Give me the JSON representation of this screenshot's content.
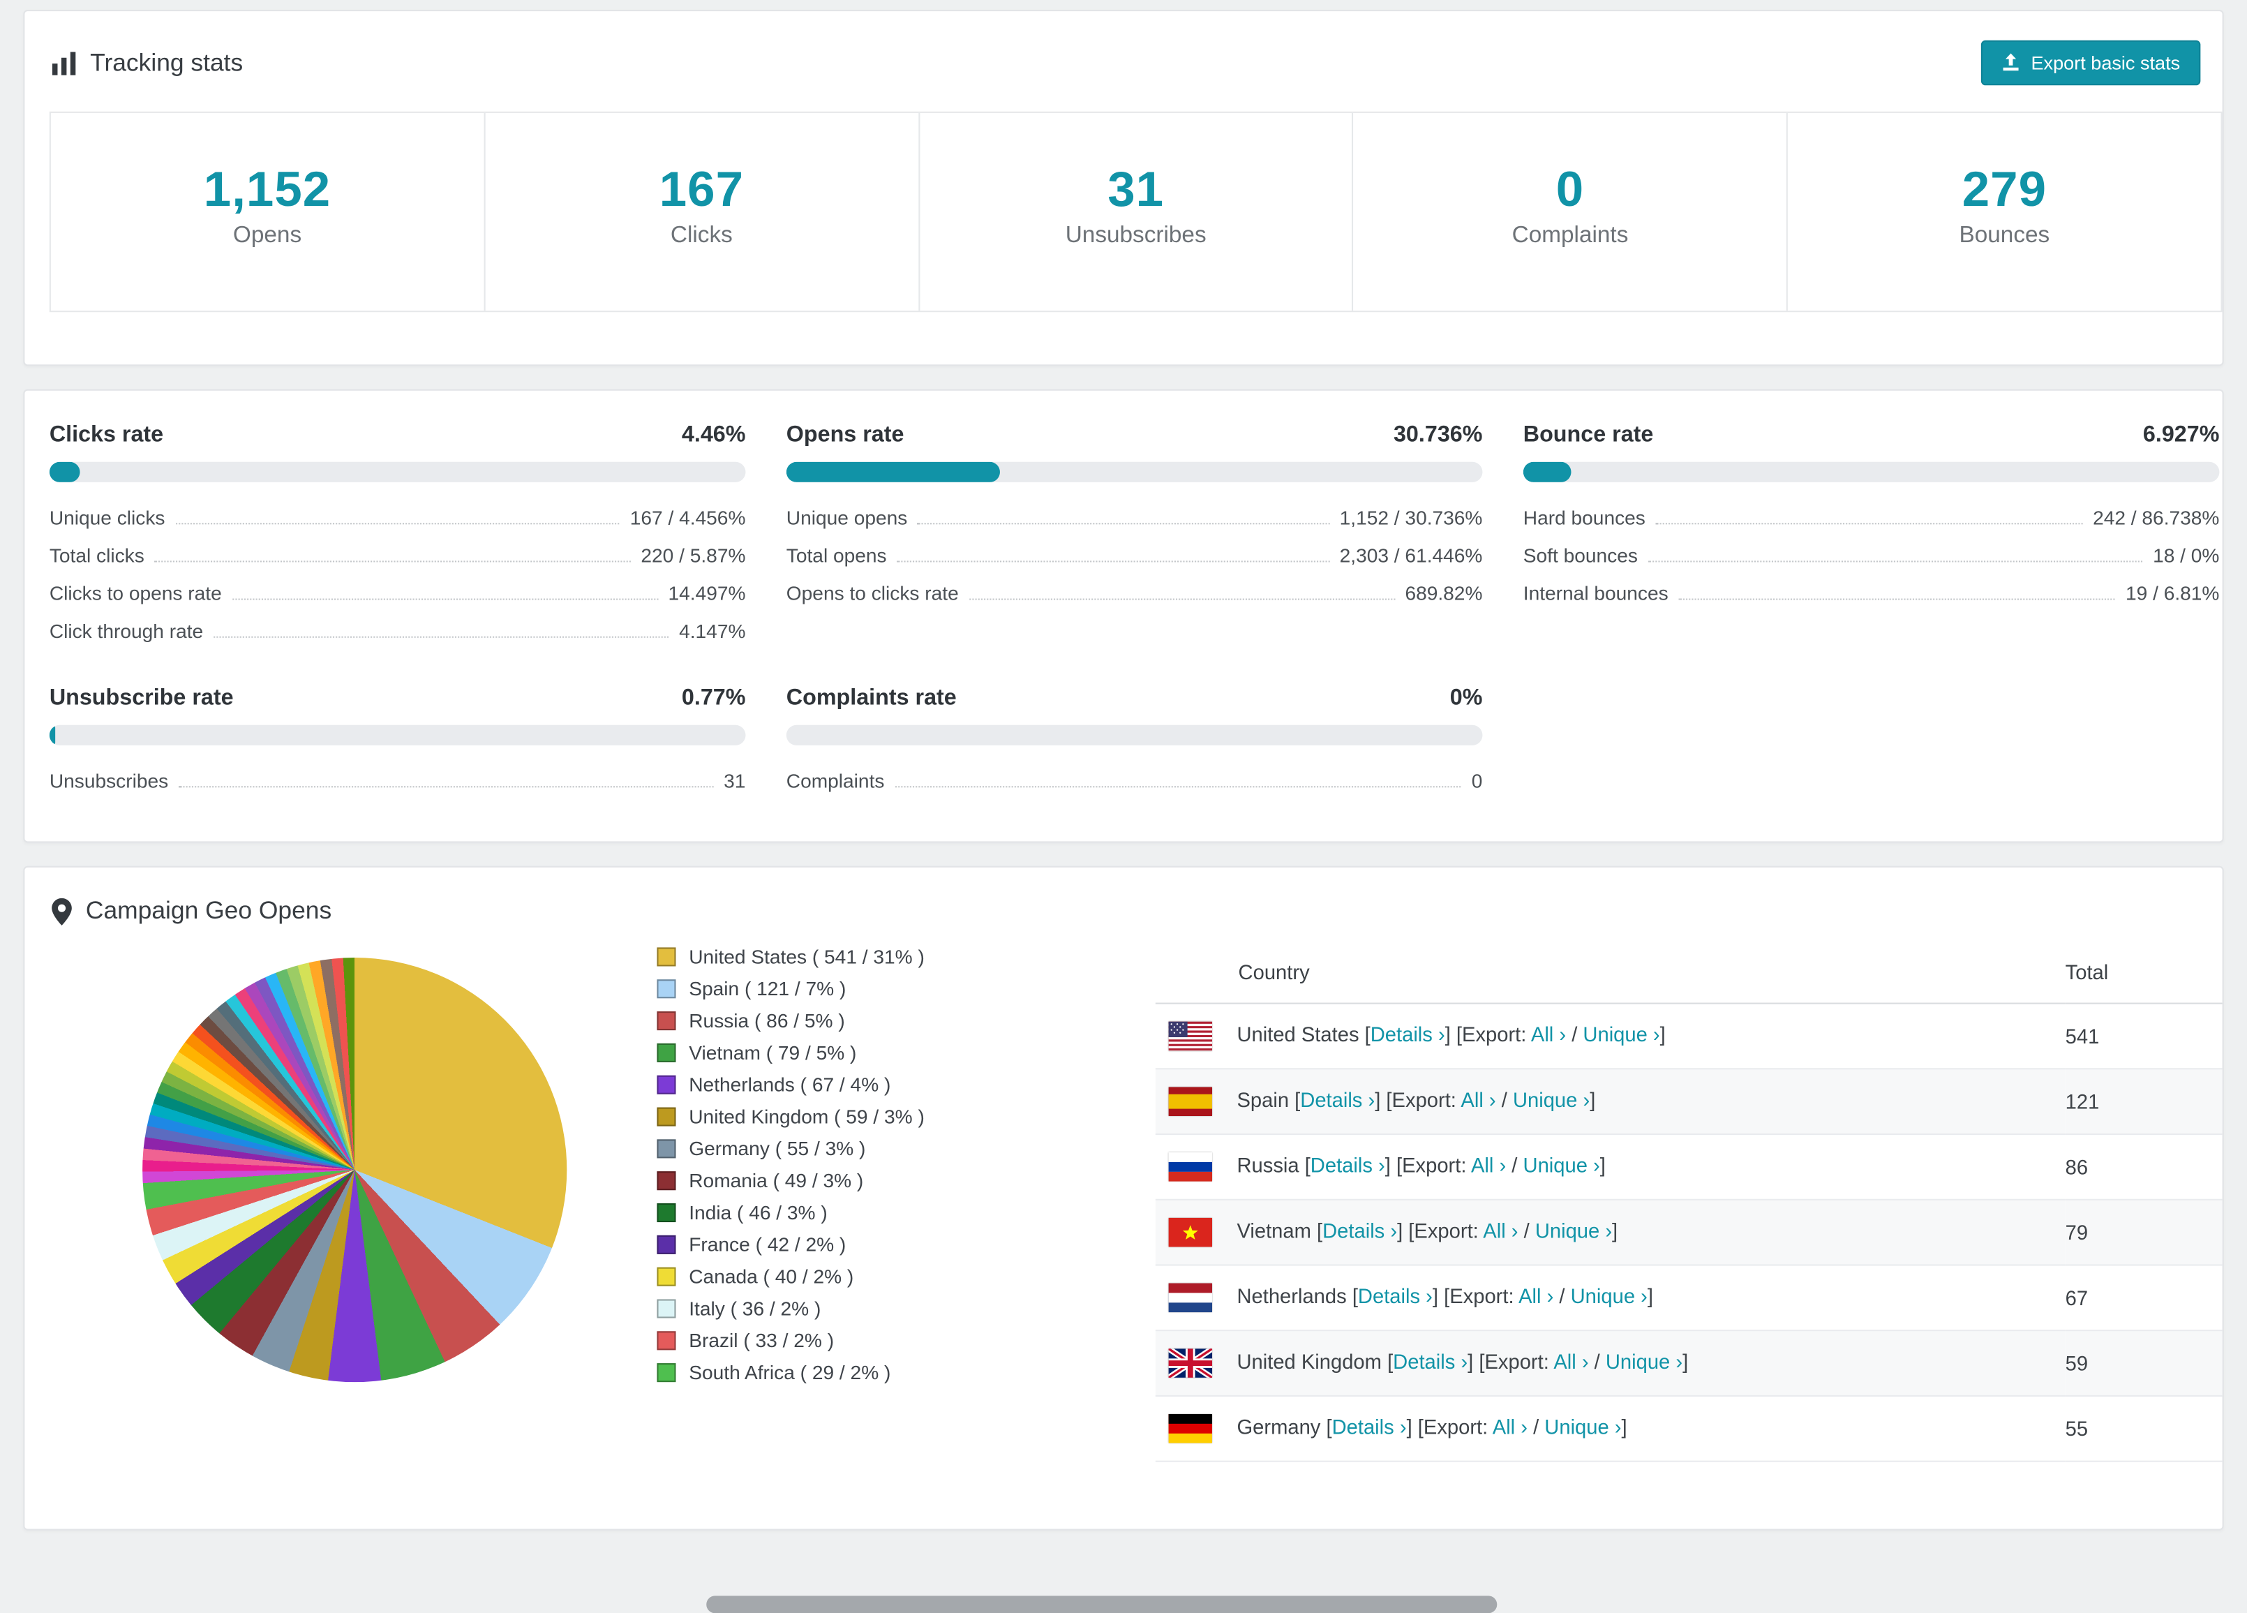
{
  "accent_color": "#1193a7",
  "tracking": {
    "title": "Tracking stats",
    "export_label": "Export basic stats",
    "stats": [
      {
        "value": "1,152",
        "label": "Opens"
      },
      {
        "value": "167",
        "label": "Clicks"
      },
      {
        "value": "31",
        "label": "Unsubscribes"
      },
      {
        "value": "0",
        "label": "Complaints"
      },
      {
        "value": "279",
        "label": "Bounces"
      }
    ]
  },
  "rates": [
    {
      "title": "Clicks rate",
      "value": "4.46%",
      "percent": 4.46,
      "rows": [
        {
          "label": "Unique clicks",
          "value": "167 / 4.456%"
        },
        {
          "label": "Total clicks",
          "value": "220 / 5.87%"
        },
        {
          "label": "Clicks to opens rate",
          "value": "14.497%"
        },
        {
          "label": "Click through rate",
          "value": "4.147%"
        }
      ]
    },
    {
      "title": "Opens rate",
      "value": "30.736%",
      "percent": 30.736,
      "rows": [
        {
          "label": "Unique opens",
          "value": "1,152 / 30.736%"
        },
        {
          "label": "Total opens",
          "value": "2,303 / 61.446%"
        },
        {
          "label": "Opens to clicks rate",
          "value": "689.82%"
        }
      ]
    },
    {
      "title": "Bounce rate",
      "value": "6.927%",
      "percent": 6.927,
      "rows": [
        {
          "label": "Hard bounces",
          "value": "242 / 86.738%"
        },
        {
          "label": "Soft bounces",
          "value": "18 / 0%"
        },
        {
          "label": "Internal bounces",
          "value": "19 / 6.81%"
        }
      ]
    },
    {
      "title": "Unsubscribe rate",
      "value": "0.77%",
      "percent": 0.77,
      "rows": [
        {
          "label": "Unsubscribes",
          "value": "31"
        }
      ]
    },
    {
      "title": "Complaints rate",
      "value": "0%",
      "percent": 0,
      "rows": [
        {
          "label": "Complaints",
          "value": "0"
        }
      ]
    }
  ],
  "geo": {
    "title": "Campaign Geo Opens",
    "legend": [
      {
        "label": "United States ( 541 / 31% )",
        "color": "#E3BE3E"
      },
      {
        "label": "Spain ( 121 / 7% )",
        "color": "#A9D3F5"
      },
      {
        "label": "Russia ( 86 / 5% )",
        "color": "#C8504F"
      },
      {
        "label": "Vietnam ( 79 / 5% )",
        "color": "#3FA344"
      },
      {
        "label": "Netherlands ( 67 / 4% )",
        "color": "#7C3BD6"
      },
      {
        "label": "United Kingdom ( 59 / 3% )",
        "color": "#BD9A1F"
      },
      {
        "label": "Germany ( 55 / 3% )",
        "color": "#7E95A8"
      },
      {
        "label": "Romania ( 49 / 3% )",
        "color": "#8C2F33"
      },
      {
        "label": "India ( 46 / 3% )",
        "color": "#1E7A2E"
      },
      {
        "label": "France ( 42 / 2% )",
        "color": "#5B2FA8"
      },
      {
        "label": "Canada ( 40 / 2% )",
        "color": "#EFDC35"
      },
      {
        "label": "Italy ( 36 / 2% )",
        "color": "#DCF4F6"
      },
      {
        "label": "Brazil ( 33 / 2% )",
        "color": "#E45B5B"
      },
      {
        "label": "South Africa ( 29 / 2% )",
        "color": "#4FBF4F"
      }
    ],
    "chart_data": {
      "type": "pie",
      "title": "Campaign Geo Opens",
      "slices": [
        {
          "label": "United States",
          "value": 541,
          "percent": 31,
          "color": "#E3BE3E"
        },
        {
          "label": "Spain",
          "value": 121,
          "percent": 7,
          "color": "#A9D3F5"
        },
        {
          "label": "Russia",
          "value": 86,
          "percent": 5,
          "color": "#C8504F"
        },
        {
          "label": "Vietnam",
          "value": 79,
          "percent": 5,
          "color": "#3FA344"
        },
        {
          "label": "Netherlands",
          "value": 67,
          "percent": 4,
          "color": "#7C3BD6"
        },
        {
          "label": "United Kingdom",
          "value": 59,
          "percent": 3,
          "color": "#BD9A1F"
        },
        {
          "label": "Germany",
          "value": 55,
          "percent": 3,
          "color": "#7E95A8"
        },
        {
          "label": "Romania",
          "value": 49,
          "percent": 3,
          "color": "#8C2F33"
        },
        {
          "label": "India",
          "value": 46,
          "percent": 3,
          "color": "#1E7A2E"
        },
        {
          "label": "France",
          "value": 42,
          "percent": 2,
          "color": "#5B2FA8"
        },
        {
          "label": "Canada",
          "value": 40,
          "percent": 2,
          "color": "#EFDC35"
        },
        {
          "label": "Italy",
          "value": 36,
          "percent": 2,
          "color": "#DCF4F6"
        },
        {
          "label": "Brazil",
          "value": 33,
          "percent": 2,
          "color": "#E45B5B"
        },
        {
          "label": "South Africa",
          "value": 29,
          "percent": 2,
          "color": "#4FBF4F"
        }
      ],
      "other_slices_total_percent": 26,
      "other_slices_colors": [
        "#D147D6",
        "#E91E8C",
        "#F06292",
        "#8E24AA",
        "#5C6BC0",
        "#1E88E5",
        "#00ACC1",
        "#00897B",
        "#43A047",
        "#7CB342",
        "#C0CA33",
        "#FDD835",
        "#FFB300",
        "#FB8C00",
        "#F4511E",
        "#6D4C41",
        "#757575",
        "#546E7A",
        "#26C6DA",
        "#EC407A",
        "#AB47BC",
        "#7E57C2",
        "#29B6F6",
        "#66BB6A",
        "#9CCC65",
        "#D4E157",
        "#FFA726",
        "#8D6E63",
        "#EF5350",
        "#5C940D"
      ]
    },
    "table": {
      "country_header": "Country",
      "total_header": "Total",
      "fmt": {
        "open_bracket": "[",
        "close_bracket": "]",
        "details": "Details",
        "export": "Export:",
        "all": "All",
        "unique": "Unique",
        "chevron": "›",
        "slash": "/"
      },
      "rows": [
        {
          "country": "United States",
          "flag": "us",
          "total": "541"
        },
        {
          "country": "Spain",
          "flag": "es",
          "total": "121"
        },
        {
          "country": "Russia",
          "flag": "ru",
          "total": "86"
        },
        {
          "country": "Vietnam",
          "flag": "vn",
          "total": "79"
        },
        {
          "country": "Netherlands",
          "flag": "nl",
          "total": "67"
        },
        {
          "country": "United Kingdom",
          "flag": "gb",
          "total": "59"
        },
        {
          "country": "Germany",
          "flag": "de",
          "total": "55"
        }
      ]
    }
  }
}
